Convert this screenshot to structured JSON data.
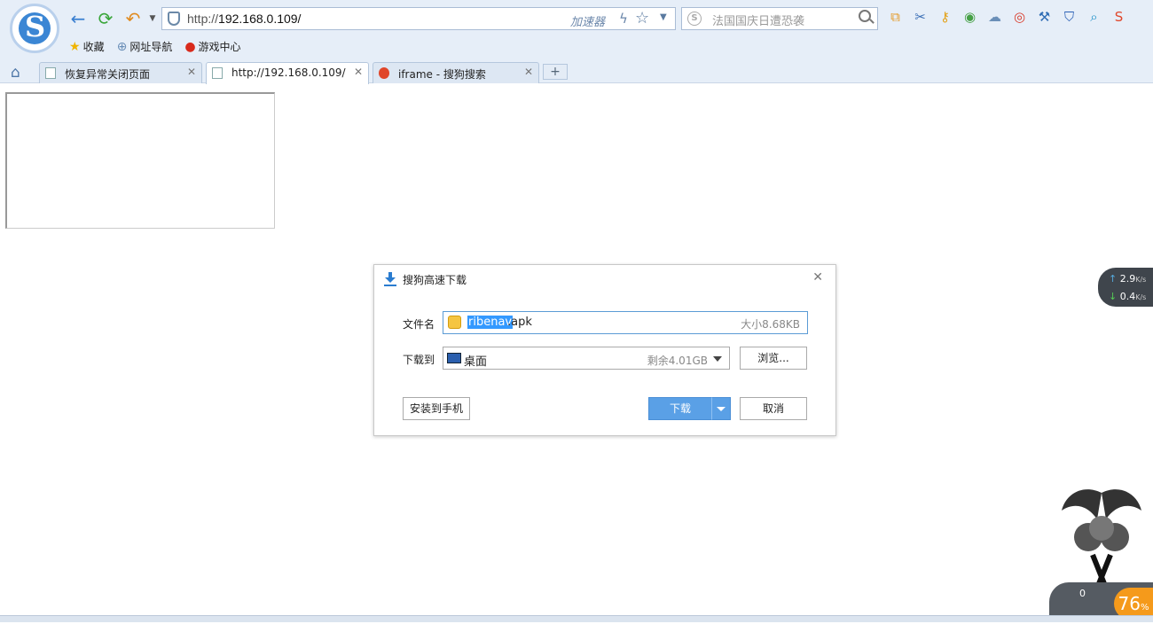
{
  "browser": {
    "address": {
      "url_prefix": "http://",
      "url_host": "192.168.0.109/",
      "accelerator_label": "加速器"
    },
    "search": {
      "placeholder": "法国国庆日遭恐袭"
    },
    "bookmarks": [
      {
        "label": "收藏",
        "icon": "star-icon"
      },
      {
        "label": "网址导航",
        "icon": "globe-icon"
      },
      {
        "label": "游戏中心",
        "icon": "game-icon"
      }
    ],
    "tabs": [
      {
        "label": "恢复异常关闭页面",
        "icon": "page-icon",
        "active": false
      },
      {
        "label": "http://192.168.0.109/",
        "icon": "page-icon",
        "active": true
      },
      {
        "label": "iframe - 搜狗搜索",
        "icon": "sogou-icon",
        "active": false
      }
    ],
    "new_tab_label": "+"
  },
  "dialog": {
    "title": "搜狗高速下载",
    "filename_label": "文件名",
    "filename_selected": "ribenav",
    "filename_ext": ".apk",
    "size_text": "大小8.68KB",
    "dest_label": "下载到",
    "dest_value": "桌面",
    "free_space": "剩余4.01GB",
    "browse_label": "浏览...",
    "install_label": "安装到手机",
    "download_label": "下载",
    "cancel_label": "取消"
  },
  "speed_widget": {
    "up": "2.9",
    "down": "0.4",
    "unit": "K/s"
  },
  "system_widget": {
    "percent": "76",
    "percent_unit": "%",
    "rate": "0"
  },
  "colors": {
    "accent": "#5aa0e6",
    "toolbar_bg": "#e6eef8",
    "selection": "#3399ff",
    "orange": "#f59a1b"
  }
}
